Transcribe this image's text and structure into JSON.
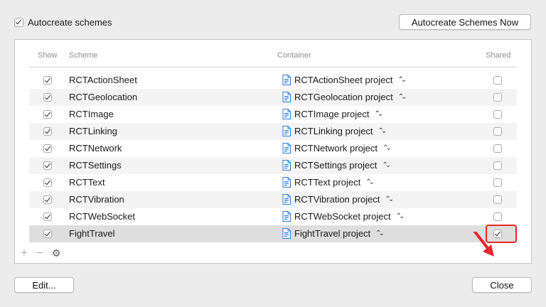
{
  "autocreate": {
    "label": "Autocreate schemes",
    "checked": true
  },
  "buttons": {
    "autocreate_now": "Autocreate Schemes Now",
    "edit": "Edit...",
    "close": "Close"
  },
  "columns": {
    "show": "Show",
    "scheme": "Scheme",
    "container": "Container",
    "shared": "Shared"
  },
  "rows": [
    {
      "show": true,
      "scheme": "RCTActionSheet",
      "container": "RCTActionSheet project",
      "shared": false
    },
    {
      "show": true,
      "scheme": "RCTGeolocation",
      "container": "RCTGeolocation project",
      "shared": false
    },
    {
      "show": true,
      "scheme": "RCTImage",
      "container": "RCTImage project",
      "shared": false
    },
    {
      "show": true,
      "scheme": "RCTLinking",
      "container": "RCTLinking project",
      "shared": false
    },
    {
      "show": true,
      "scheme": "RCTNetwork",
      "container": "RCTNetwork project",
      "shared": false
    },
    {
      "show": true,
      "scheme": "RCTSettings",
      "container": "RCTSettings project",
      "shared": false
    },
    {
      "show": true,
      "scheme": "RCTText",
      "container": "RCTText project",
      "shared": false
    },
    {
      "show": true,
      "scheme": "RCTVibration",
      "container": "RCTVibration project",
      "shared": false
    },
    {
      "show": true,
      "scheme": "RCTWebSocket",
      "container": "RCTWebSocket project",
      "shared": false
    },
    {
      "show": true,
      "scheme": "FightTravel",
      "container": "FightTravel project",
      "shared": true,
      "selected": true
    }
  ],
  "toolbar": {
    "add": "+",
    "remove": "−",
    "gear": "⚙"
  },
  "colors": {
    "annotation": "#e8262a",
    "selection": "#dedede",
    "project_icon": "#2a7bd8"
  },
  "icons": {
    "project": "xcode-project-icon",
    "chevron": "up-down-chevron-icon",
    "gear": "gear-icon",
    "arrow": "red-arrow-annotation"
  }
}
